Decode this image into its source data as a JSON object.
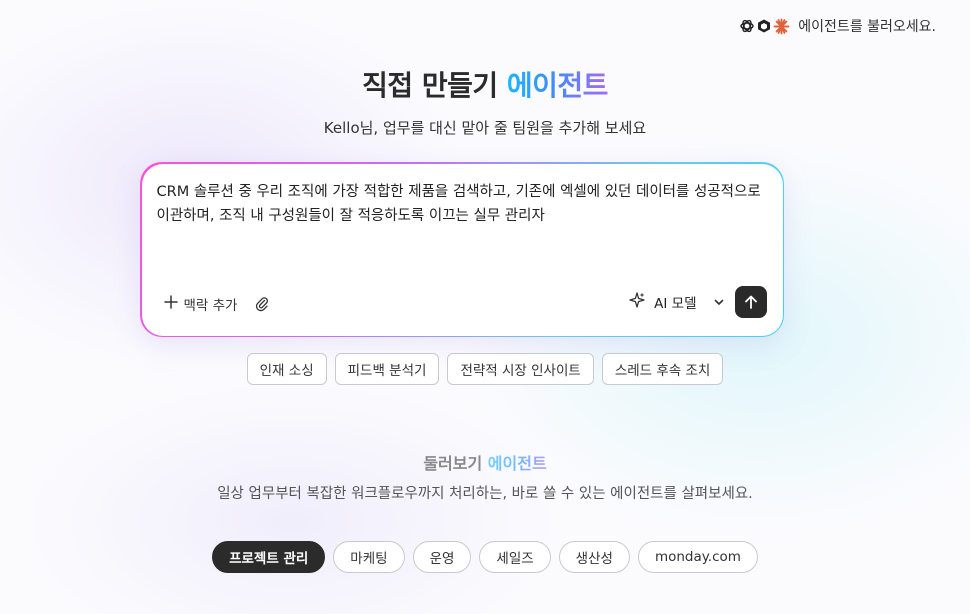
{
  "header": {
    "brand_icons": [
      "openai-icon",
      "box-icon",
      "anthropic-icon"
    ],
    "load_agent_label": "에이전트를 불러오세요."
  },
  "hero": {
    "title_main": "직접 만들기 ",
    "title_accent": "에이전트",
    "subtitle": "Kello님, 업무를 대신 맡아 줄 팀원을 추가해 보세요"
  },
  "prompt": {
    "text": "CRM 솔루션 중 우리 조직에 가장 적합한 제품을 검색하고, 기존에 엑셀에 있던 데이터를 성공적으로 이관하며, 조직 내 구성원들이 잘 적응하도록 이끄는 실무 관리자",
    "add_context_label": "맥락 추가",
    "model_label": "AI 모델",
    "colors": {
      "border_start": "#ff4fd8",
      "border_end": "#3fd2ff",
      "send_bg": "#2a2a2a"
    }
  },
  "suggestions": [
    "인재 소싱",
    "피드백 분석기",
    "전략적 시장 인사이트",
    "스레드 후속 조치"
  ],
  "explore": {
    "title_main": "둘러보기 ",
    "title_accent": "에이전트",
    "subtitle": "일상 업무부터 복잡한 워크플로우까지 처리하는, 바로 쓸 수 있는 에이전트를 살펴보세요.",
    "tabs": [
      "프로젝트 관리",
      "마케팅",
      "운영",
      "세일즈",
      "생산성",
      "monday.com"
    ],
    "active_tab": "프로젝트 관리"
  }
}
